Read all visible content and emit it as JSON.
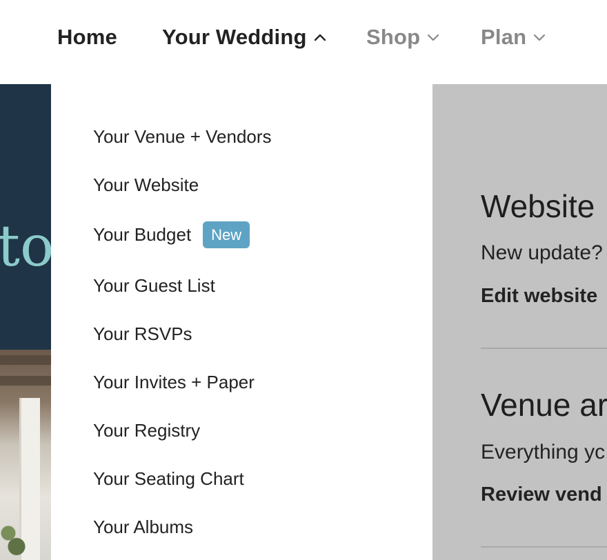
{
  "nav": {
    "items": [
      {
        "label": "Home"
      },
      {
        "label": "Your Wedding"
      },
      {
        "label": "Shop"
      },
      {
        "label": "Plan"
      }
    ]
  },
  "hero": {
    "partial_text": "to"
  },
  "dropdown": {
    "items": [
      {
        "label": "Your Venue + Vendors"
      },
      {
        "label": "Your Website"
      },
      {
        "label": "Your Budget",
        "badge": "New"
      },
      {
        "label": "Your Guest List"
      },
      {
        "label": "Your RSVPs"
      },
      {
        "label": "Your Invites + Paper"
      },
      {
        "label": "Your Registry"
      },
      {
        "label": "Your Seating Chart"
      },
      {
        "label": "Your Albums"
      }
    ]
  },
  "panel": {
    "sections": [
      {
        "title": "Website",
        "desc": "New update?",
        "link": "Edit website"
      },
      {
        "title": "Venue ar",
        "desc": "Everything yc",
        "link": "Review vend"
      }
    ]
  },
  "colors": {
    "hero_dark": "#1f3446",
    "hero_text": "#8ccbcb",
    "badge": "#5ea3c4",
    "panel_bg": "#c2c2c2"
  }
}
